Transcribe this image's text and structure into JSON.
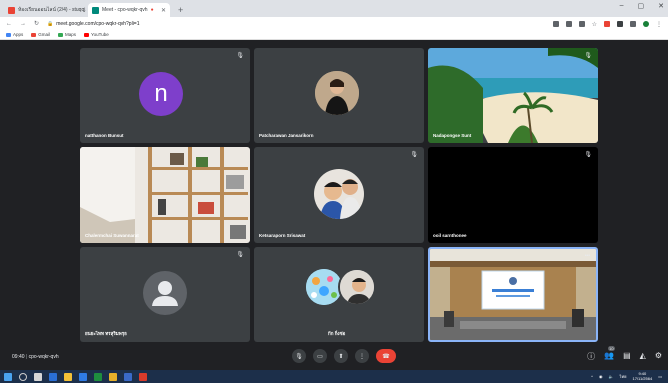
{
  "browser": {
    "tabs": [
      {
        "title": "ห้องเรียนออนไลน์ (2/4) - stuqqj.cmi",
        "active": false
      },
      {
        "title": "Meet - cpo-wqkr-qvh",
        "active": true
      }
    ],
    "url": "meet.google.com/cpo-wqkr-qvh?pli=1",
    "bookmarks": [
      "Apps",
      "Gmail",
      "Maps",
      "YouTube"
    ]
  },
  "participants": [
    {
      "name": "natthanon Bunsut",
      "type": "avatar",
      "initial": "n",
      "avatar_color": "#7e3fcb"
    },
    {
      "name": "Patcharawan Jansarikorn",
      "type": "photo"
    },
    {
      "name": "Nadapongse Sunt",
      "type": "beach"
    },
    {
      "name": "Chalermchai Suwannarat",
      "type": "shelf"
    },
    {
      "name": "Ketsaraporn Srisawat",
      "type": "child"
    },
    {
      "name": "ooil sarnthonee",
      "type": "dark"
    },
    {
      "name": "ยนยะไหท ทรสุริมพรุธ",
      "type": "avatar-gray"
    },
    {
      "name": "กีก กิ่งช่อ",
      "type": "two-circles"
    },
    {
      "name": "You",
      "type": "conference"
    }
  ],
  "meeting": {
    "time": "09:40",
    "code": "cpo-wqkr-qvh",
    "participant_count": "10"
  },
  "colors": {
    "end_call": "#ea4335",
    "meet_bg": "#202124",
    "tile_bg": "#3c4043",
    "active_border": "#8ab4f8"
  },
  "taskbar": {
    "time": "9:40",
    "date": "17/11/2564"
  }
}
